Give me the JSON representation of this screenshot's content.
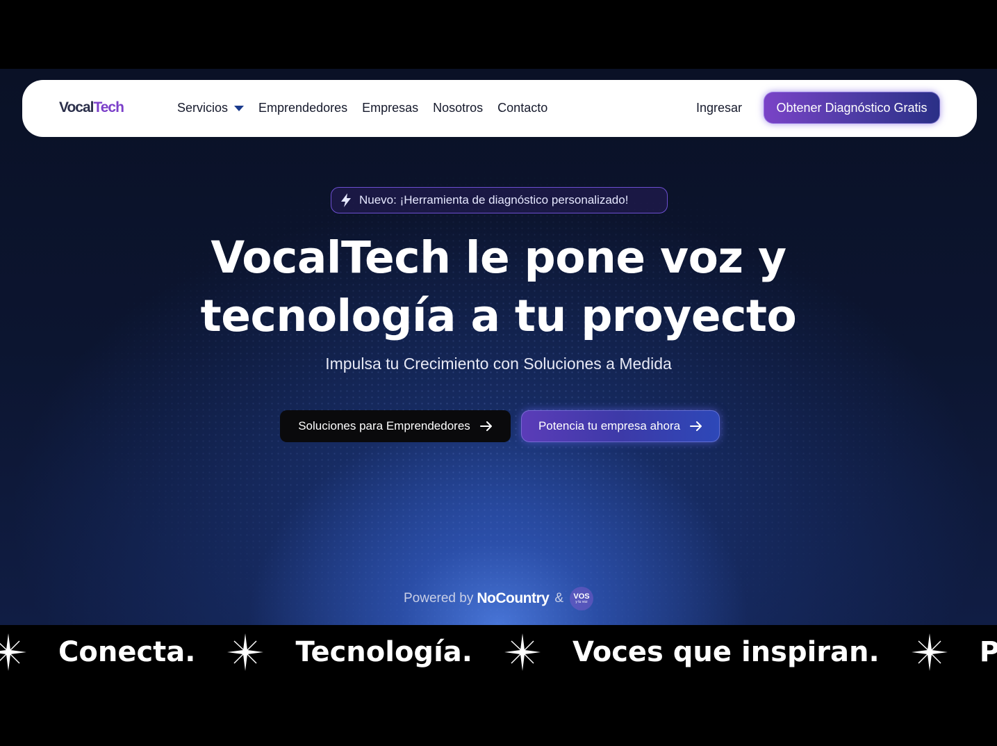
{
  "brand": {
    "logo_part1": "Vocal",
    "logo_part2": "Tech"
  },
  "nav": {
    "items": [
      {
        "label": "Servicios"
      },
      {
        "label": "Emprendedores"
      },
      {
        "label": "Empresas"
      },
      {
        "label": "Nosotros"
      },
      {
        "label": "Contacto"
      }
    ],
    "login": "Ingresar",
    "cta": "Obtener Diagnóstico Gratis"
  },
  "hero": {
    "badge": "Nuevo: ¡Herramienta de diagnóstico personalizado!",
    "title_line1": "VocalTech le pone voz y",
    "title_line2": "tecnología a tu proyecto",
    "subtitle": "Impulsa tu Crecimiento con Soluciones a Medida",
    "btn_primary": "Soluciones para Emprendedores",
    "btn_secondary": "Potencia tu empresa ahora",
    "powered_by": "Powered by",
    "partner1": "NoCountry",
    "amp": "&",
    "partner2_top": "VOS",
    "partner2_bottom": "y tu voz"
  },
  "marquee": {
    "words": [
      "Conecta.",
      "Tecnología.",
      "Voces que inspiran.",
      "Persuade co"
    ]
  },
  "colors": {
    "accent_purple": "#7b3fc9",
    "hero_bg": "#0c1530",
    "glow_blue": "#4a78dc"
  }
}
